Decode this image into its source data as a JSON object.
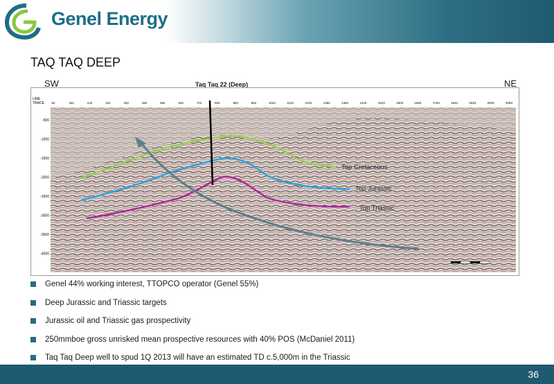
{
  "brand": {
    "name": "Genel Energy"
  },
  "slide": {
    "title": "TAQ TAQ DEEP",
    "page_number": "36"
  },
  "section": {
    "left_label": "SW",
    "right_label": "NE",
    "well_label": "Taq Taq 22 (Deep)",
    "row_labels": [
      "LINE",
      "TRACE"
    ],
    "trace_values": [
      "82",
      "162",
      "242",
      "322",
      "402",
      "482",
      "562",
      "642",
      "722",
      "802",
      "882",
      "962",
      "1042",
      "1122",
      "1202",
      "1282",
      "1362",
      "1443",
      "1523",
      "1603",
      "1683",
      "1763",
      "1843",
      "1923",
      "2003",
      "2083"
    ],
    "depth_ticks": [
      "-500",
      "-1000",
      "-1500",
      "-2000",
      "-2500",
      "-3000",
      "-3500",
      "-4000"
    ],
    "horizons": [
      {
        "name": "Top Cretaceous",
        "color": "#93d14f"
      },
      {
        "name": "Top Jurassic",
        "color": "#2ea3dc"
      },
      {
        "name": "Top Triassic",
        "color": "#b0239e"
      }
    ],
    "arrow_color": "#5a7f8c"
  },
  "bullets": [
    "Genel 44% working interest, TTOPCO operator (Genel 55%)",
    "Deep Jurassic and Triassic targets",
    "Jurassic oil and Triassic gas prospectivity",
    "250mmboe gross unrisked mean prospective resources with 40% POS (McDaniel 2011)",
    "Taq Taq Deep well to spud 1Q 2013 will have an estimated TD c.5,000m in the Triassic"
  ]
}
